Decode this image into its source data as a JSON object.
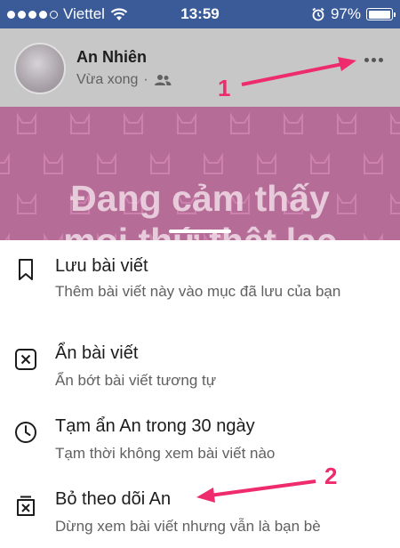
{
  "status_bar": {
    "carrier": "Viettel",
    "time": "13:59",
    "battery": "97%",
    "battery_level": 0.97,
    "signal_bars": 4
  },
  "post": {
    "author": "An Nhiên",
    "time": "Vừa xong",
    "audience_icon": "friends-icon",
    "title_line1": "Đang cảm thấy",
    "title_line2": "mọi thứ thật lạc"
  },
  "menu": {
    "items": [
      {
        "title": "Lưu bài viết",
        "subtitle": "Thêm bài viết này vào mục đã lưu của bạn",
        "icon": "bookmark-icon"
      },
      {
        "title": "Ẩn bài viết",
        "subtitle": "Ẩn bớt bài viết tương tự",
        "icon": "hide-post-icon"
      },
      {
        "title": "Tạm ẩn An trong 30 ngày",
        "subtitle": "Tạm thời không xem bài viết nào",
        "icon": "clock-icon"
      },
      {
        "title": "Bỏ theo dõi An",
        "subtitle": "Dừng xem bài viết nhưng vẫn là bạn bè",
        "icon": "unfollow-icon"
      }
    ]
  },
  "annotations": {
    "label_1": "1",
    "label_2": "2",
    "color": "#ee2b6c"
  },
  "colors": {
    "status_bar": "#3b5b98",
    "post_image": "#b56c97"
  }
}
